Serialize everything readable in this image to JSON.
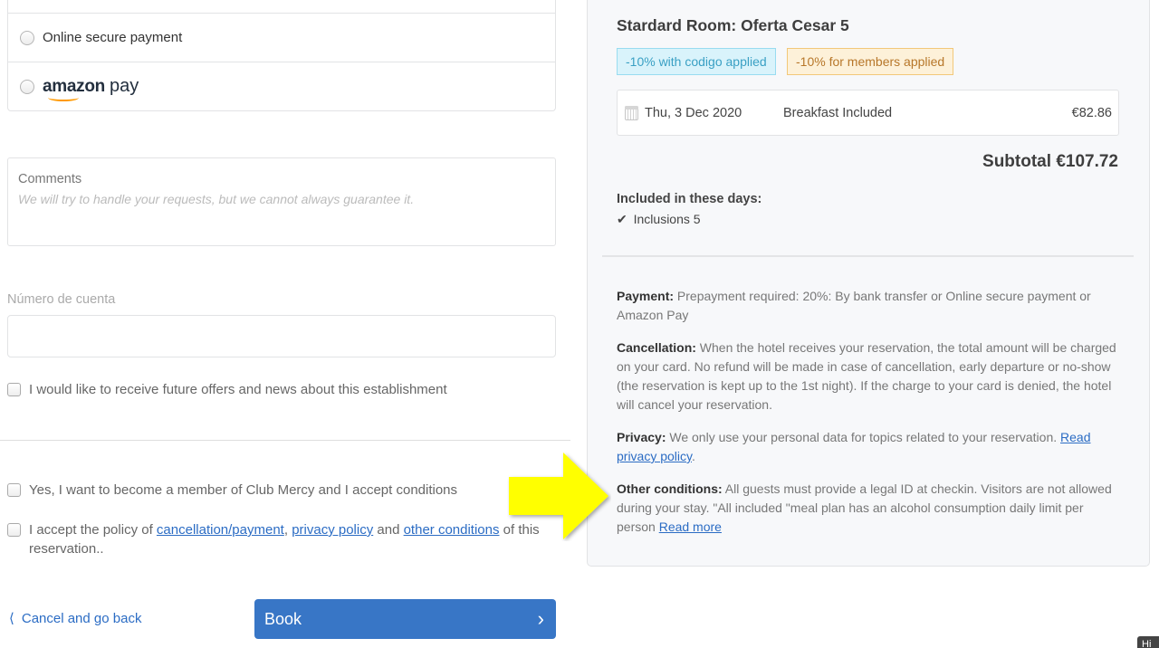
{
  "payment_methods": {
    "options": [
      {
        "label": "Online secure payment",
        "selected": false
      },
      {
        "label_brand": "amazon",
        "label_suffix": "pay",
        "selected": false
      }
    ]
  },
  "comments": {
    "label": "Comments",
    "placeholder": "We will try to handle your requests, but we cannot always guarantee it."
  },
  "account": {
    "label": "Número de cuenta",
    "value": "",
    "placeholder": ""
  },
  "checkboxes": {
    "offers": {
      "label": "I would like to receive future offers and news about this establishment",
      "checked": false
    },
    "club": {
      "label": "Yes, I want to become a member of Club Mercy and I accept conditions",
      "checked": false
    },
    "policy": {
      "checked": false,
      "prefix": "I accept the policy of ",
      "link1": "cancellation/payment",
      "sep1": ", ",
      "link2": "privacy policy",
      "sep2": " and ",
      "link3": "other conditions",
      "suffix": " of this reservation.."
    }
  },
  "actions": {
    "cancel_label": "Cancel and go back",
    "cancel_icon": "chevron-left-icon",
    "book_label": "Book",
    "book_icon": "chevron-right-icon"
  },
  "summary": {
    "room_title": "Stardard Room: Oferta Cesar 5",
    "badges": [
      {
        "label": "-10% with codigo applied",
        "color": "#3aa0c4"
      },
      {
        "label": "-10% for members applied",
        "color": "#b7772a"
      }
    ],
    "days": [
      {
        "date": "Thu, 3 Dec 2020",
        "description": "Breakfast Included",
        "price": "€82.86"
      }
    ],
    "subtotal_label": "Subtotal",
    "subtotal_value": "€107.72",
    "included_title": "Included in these days:",
    "included_items": [
      "Inclusions 5"
    ]
  },
  "policies": {
    "payment": {
      "label": "Payment:",
      "text": " Prepayment required: 20%: By bank transfer or Online secure payment or Amazon Pay"
    },
    "cancellation": {
      "label": "Cancellation:",
      "text": " When the hotel receives your reservation, the total amount will be charged on your card. No refund will be made in case of cancellation, early departure or no-show (the reservation is kept up to the 1st night). If the charge to your card is denied, the hotel will cancel your reservation."
    },
    "privacy": {
      "label": "Privacy:",
      "text": " We only use your personal data for topics related to your reservation. ",
      "link": "Read privacy policy",
      "after": "."
    },
    "other": {
      "label": "Other conditions:",
      "text": " All guests must provide a legal ID at checkin. Visitors are not allowed during your stay. \"All included \"meal plan has an alcohol consumption daily limit per person ",
      "link": "Read more"
    }
  },
  "annotation": {
    "type": "arrow",
    "color": "#ffff00",
    "points_to": "other-conditions"
  },
  "hint_tab": {
    "label": "Hi"
  },
  "colors": {
    "accent": "#3876c6",
    "link": "#2b6cc4",
    "panel_bg": "#f7f8fa"
  }
}
